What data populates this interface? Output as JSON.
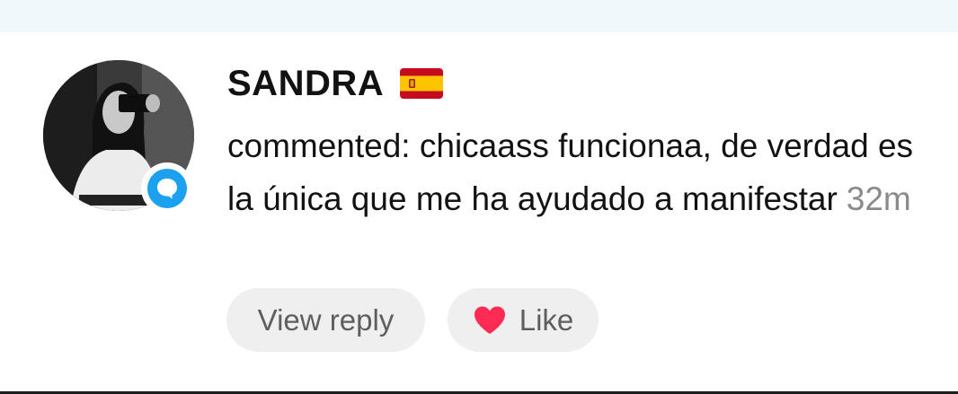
{
  "comment": {
    "username": "SANDRA",
    "flag_icon": "spain-flag-icon",
    "text": "commented: chicaass funcionaa, de verdad es la única que me ha ayudado a manifestar",
    "time": "32m",
    "badge_icon": "comment-bubble-icon"
  },
  "actions": {
    "view_reply_label": "View reply",
    "like_label": "Like",
    "like_icon": "heart-icon"
  },
  "colors": {
    "badge_blue": "#1ca1f1",
    "heart_red": "#fe2c55",
    "pill_bg": "#efefef",
    "muted_text": "#8a8a8a"
  }
}
